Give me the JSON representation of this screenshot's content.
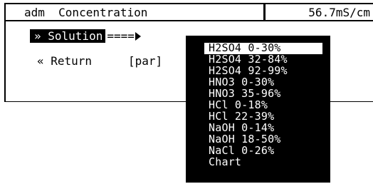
{
  "header": {
    "title": "adm  Concentration",
    "value": "56.7mS/cm"
  },
  "panel": {
    "solution_label": "» Solution",
    "solution_arrow": "====",
    "return_label": "« Return",
    "par_label": "[par]"
  },
  "menu": {
    "items": [
      "H2SO4 0-30%",
      "H2SO4 32-84%",
      "H2SO4 92-99%",
      "HNO3 0-30%",
      "HNO3 35-96%",
      "HCl 0-18%",
      "HCl 22-39%",
      "NaOH 0-14%",
      "NaOH 18-50%",
      "NaCl 0-26%",
      "Chart"
    ],
    "selected_index": 0
  }
}
